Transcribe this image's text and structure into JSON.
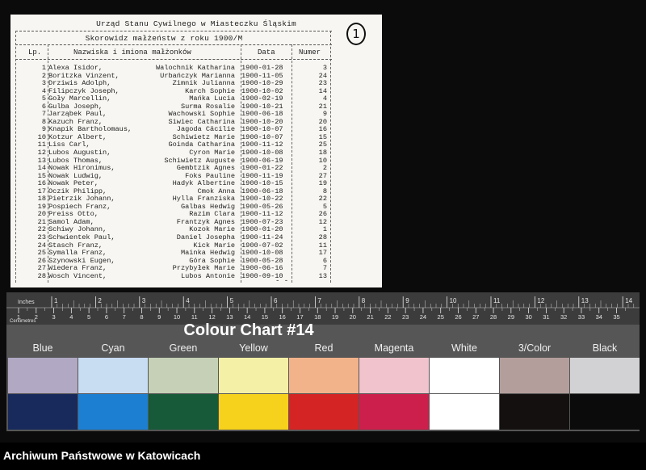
{
  "document": {
    "title": "Urząd Stanu Cywilnego w Miasteczku Śląskim",
    "subtitle": "Skorowidz małżeństw z roku 1900/M",
    "handwritten_mark": "1",
    "headers": {
      "lp": "Lp.",
      "names": "Nazwiska i imiona małżonków",
      "date": "Data",
      "number": "Numer"
    },
    "rows": [
      {
        "lp": "1",
        "male": "Alexa Isidor,",
        "female": "Walochnik Katharina",
        "date": "1900-01-28",
        "num": "3"
      },
      {
        "lp": "2",
        "male": "Boritzka Vinzent,",
        "female": "Urbańczyk Marianna",
        "date": "1900-11-05",
        "num": "24"
      },
      {
        "lp": "3",
        "male": "Drziwis Adolph,",
        "female": "Zimnik Julianna",
        "date": "1900-10-29",
        "num": "23"
      },
      {
        "lp": "4",
        "male": "Filipczyk Joseph,",
        "female": "Karch Sophie",
        "date": "1900-10-02",
        "num": "14"
      },
      {
        "lp": "5",
        "male": "Goły Marcellin,",
        "female": "Mańka Lucia",
        "date": "1900-02-19",
        "num": "4"
      },
      {
        "lp": "6",
        "male": "Gulba Joseph,",
        "female": "Surma Rosalie",
        "date": "1900-10-21",
        "num": "21"
      },
      {
        "lp": "7",
        "male": "Jarząbek Paul,",
        "female": "Wachowski Sophie",
        "date": "1900-06-18",
        "num": "9"
      },
      {
        "lp": "8",
        "male": "Kazuch Franz,",
        "female": "Siwiec Catharina",
        "date": "1900-10-20",
        "num": "20"
      },
      {
        "lp": "9",
        "male": "Knapik Bartholomaus,",
        "female": "Jagoda Cäcilie",
        "date": "1900-10-07",
        "num": "16"
      },
      {
        "lp": "10",
        "male": "Kotzur Albert,",
        "female": "Schiwietz Marie",
        "date": "1900-10-07",
        "num": "15"
      },
      {
        "lp": "11",
        "male": "Liss Carl,",
        "female": "Goinda Catharina",
        "date": "1900-11-12",
        "num": "25"
      },
      {
        "lp": "12",
        "male": "Lubos Augustin,",
        "female": "Cyron Marie",
        "date": "1900-10-08",
        "num": "18"
      },
      {
        "lp": "13",
        "male": "Lubos Thomas,",
        "female": "Schiwietz Auguste",
        "date": "1900-06-19",
        "num": "10"
      },
      {
        "lp": "14",
        "male": "Nowak Hironimus,",
        "female": "Gembtzik Agnes",
        "date": "1900-01-22",
        "num": "2"
      },
      {
        "lp": "15",
        "male": "Nowak Ludwig,",
        "female": "Foks Pauline",
        "date": "1900-11-19",
        "num": "27"
      },
      {
        "lp": "16",
        "male": "Nowak Peter,",
        "female": "Hadyk Albertine",
        "date": "1900-10-15",
        "num": "19"
      },
      {
        "lp": "17",
        "male": "Oczik Philipp,",
        "female": "Cmok Anna",
        "date": "1900-06-18",
        "num": "8"
      },
      {
        "lp": "18",
        "male": "Pietrzik Johann,",
        "female": "Hylla Franziska",
        "date": "1900-10-22",
        "num": "22"
      },
      {
        "lp": "19",
        "male": "Pospiech Franz,",
        "female": "Galbas Hedwig",
        "date": "1900-05-26",
        "num": "5"
      },
      {
        "lp": "20",
        "male": "Preiss Otto,",
        "female": "Razim Clara",
        "date": "1900-11-12",
        "num": "26"
      },
      {
        "lp": "21",
        "male": "Samol Adam,",
        "female": "Frantzyk Agnes",
        "date": "1900-07-23",
        "num": "12"
      },
      {
        "lp": "22",
        "male": "Schiwy Johann,",
        "female": "Kozok Marie",
        "date": "1900-01-20",
        "num": "1"
      },
      {
        "lp": "23",
        "male": "Schwientek Paul,",
        "female": "Daniel Josepha",
        "date": "1900-11-24",
        "num": "28"
      },
      {
        "lp": "24",
        "male": "Stasch Franz,",
        "female": "Kick Marie",
        "date": "1900-07-02",
        "num": "11"
      },
      {
        "lp": "25",
        "male": "Symalla Franz,",
        "female": "Mainka Hedwig",
        "date": "1900-10-08",
        "num": "17"
      },
      {
        "lp": "26",
        "male": "Szynowski Eugen,",
        "female": "Góra Sophie",
        "date": "1900-05-28",
        "num": "6"
      },
      {
        "lp": "27",
        "male": "Wiedera Franz,",
        "female": "Przybyłek Marie",
        "date": "1900-06-16",
        "num": "7"
      },
      {
        "lp": "28",
        "male": "Wosch Vincent,",
        "female": "Lubos Antonie",
        "date": "1900-09-10",
        "num": "13"
      }
    ],
    "trailing_mark": "- -"
  },
  "color_chart": {
    "title": "Colour Chart #14",
    "ruler_inches_label": "Inches",
    "ruler_cm_label": "Centimetres",
    "inch_numbers": [
      "1",
      "2",
      "3",
      "4",
      "5",
      "6",
      "7",
      "8",
      "9",
      "10",
      "11",
      "12",
      "13",
      "14"
    ],
    "cm_numbers": [
      "1",
      "2",
      "3",
      "4",
      "5",
      "6",
      "7",
      "8",
      "9",
      "10",
      "11",
      "12",
      "13",
      "14",
      "15",
      "16",
      "17",
      "18",
      "19",
      "20",
      "21",
      "22",
      "23",
      "24",
      "25",
      "26",
      "27",
      "28",
      "29",
      "30",
      "31",
      "32",
      "33",
      "34",
      "35"
    ],
    "swatches": [
      {
        "label": "Blue",
        "light": "#b1a8c4",
        "dark": "#182a5c"
      },
      {
        "label": "Cyan",
        "light": "#c8dcf2",
        "dark": "#1c7fd2"
      },
      {
        "label": "Green",
        "light": "#c5d0b6",
        "dark": "#165a3a"
      },
      {
        "label": "Yellow",
        "light": "#f4f0a6",
        "dark": "#f6d21c"
      },
      {
        "label": "Red",
        "light": "#f3b38a",
        "dark": "#d42424"
      },
      {
        "label": "Magenta",
        "light": "#f1c3cc",
        "dark": "#cc1f4c"
      },
      {
        "label": "White",
        "light": "#ffffff",
        "dark": "#ffffff"
      },
      {
        "label": "3/Color",
        "light": "#b49e9c",
        "dark": "#141010"
      },
      {
        "label": "Black",
        "light": "#d2d2d4",
        "dark": "#0c0b0b"
      }
    ]
  },
  "footer": {
    "text": "Archiwum Państwowe w Katowicach"
  }
}
